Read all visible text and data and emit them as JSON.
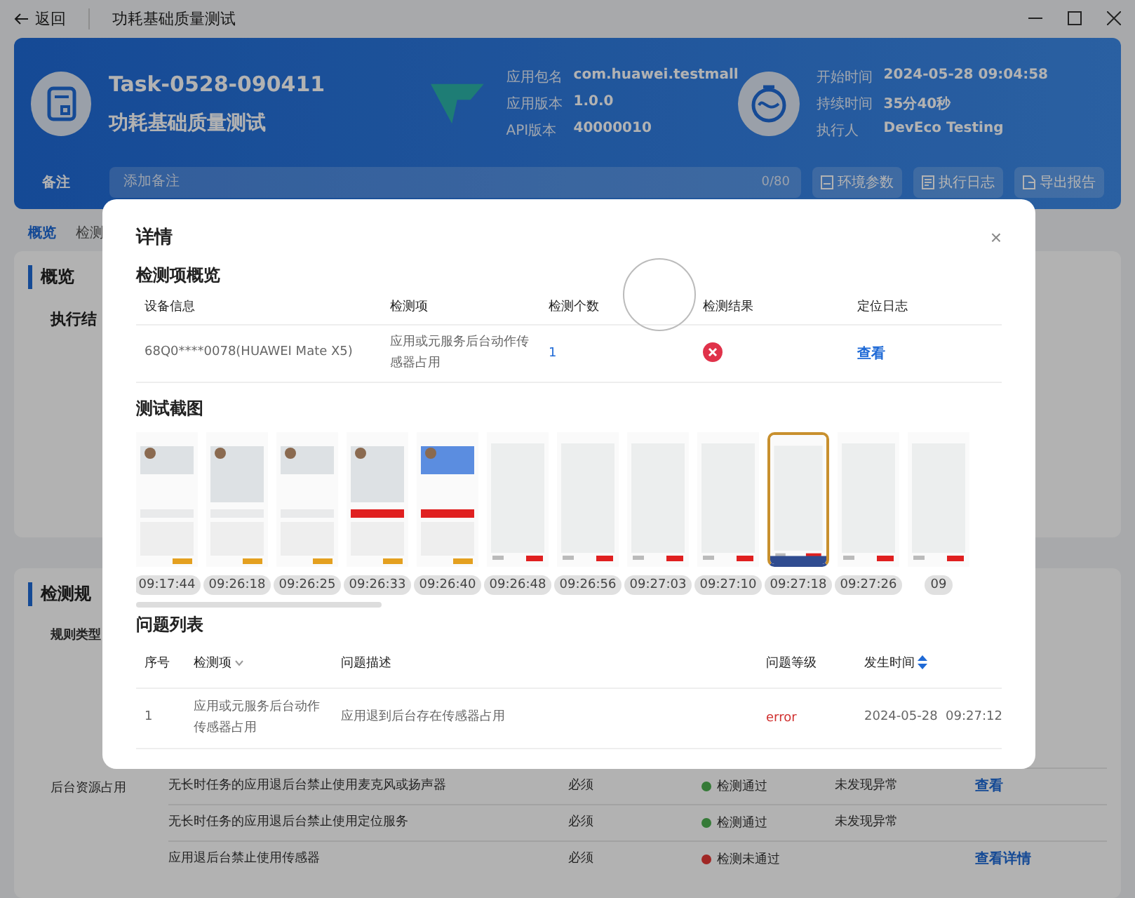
{
  "titlebar": {
    "back": "返回",
    "title": "功耗基础质量测试"
  },
  "header": {
    "task_id": "Task-0528-090411",
    "task_name": "功耗基础质量测试",
    "app_info": [
      {
        "label": "应用包名",
        "value": "com.huawei.testmall"
      },
      {
        "label": "应用版本",
        "value": "1.0.0"
      },
      {
        "label": "API版本",
        "value": "40000010"
      }
    ],
    "run_info": [
      {
        "label": "开始时间",
        "value": "2024-05-28 09:04:58"
      },
      {
        "label": "持续时间",
        "value": "35分40秒"
      },
      {
        "label": "执行人",
        "value": "DevEco Testing"
      }
    ],
    "note_label": "备注",
    "note": {
      "placeholder": "添加备注",
      "counter": "0/80"
    },
    "buttons": [
      {
        "kind": "env",
        "label": "环境参数"
      },
      {
        "kind": "log",
        "label": "执行日志"
      },
      {
        "kind": "export",
        "label": "导出报告"
      }
    ]
  },
  "tabs": [
    {
      "label": "概览",
      "selected": true
    },
    {
      "label": "检测",
      "selected": false
    }
  ],
  "overview": {
    "title": "概览",
    "result_label": "执行结"
  },
  "rules": {
    "title": "检测规",
    "type_header": "规则类型",
    "rows": [
      {
        "type": "后台资源占用",
        "name": "无长时任务的应用退后台禁止使用麦克风或扬声器",
        "level": "必须",
        "passed": true,
        "status": "检测通过",
        "result": "未发现异常",
        "action": "查看"
      },
      {
        "name": "无长时任务的应用退后台禁止使用定位服务",
        "level": "必须",
        "passed": true,
        "status": "检测通过",
        "result": "未发现异常"
      },
      {
        "name": "应用退后台禁止使用传感器",
        "level": "必须",
        "passed": false,
        "status": "检测未通过",
        "action": "查看详情"
      }
    ]
  },
  "dialog": {
    "title": "详情",
    "close": "×",
    "overview_title": "检测项概览",
    "overview_columns": [
      "设备信息",
      "检测项",
      "检测个数",
      "检测结果",
      "定位日志"
    ],
    "overview_row": {
      "device": "68Q0****0078(HUAWEI Mate X5)",
      "item": "应用或元服务后台动作传感器占用",
      "count": "1",
      "passed": false,
      "log": "查看"
    },
    "screenshots_title": "测试截图",
    "screenshots": [
      {
        "time": "09:17:44",
        "selected": false
      },
      {
        "time": "09:26:18",
        "selected": false
      },
      {
        "time": "09:26:25",
        "selected": false
      },
      {
        "time": "09:26:33",
        "selected": false
      },
      {
        "time": "09:26:40",
        "selected": false
      },
      {
        "time": "09:26:48",
        "selected": false
      },
      {
        "time": "09:26:56",
        "selected": false
      },
      {
        "time": "09:27:03",
        "selected": false
      },
      {
        "time": "09:27:10",
        "selected": false
      },
      {
        "time": "09:27:18",
        "selected": true
      },
      {
        "time": "09:27:26",
        "selected": false
      },
      {
        "time": "09",
        "selected": false
      }
    ],
    "issues_title": "问题列表",
    "issue_columns": [
      "序号",
      "检测项",
      "问题描述",
      "问题等级",
      "发生时间"
    ],
    "issues": [
      {
        "no": "1",
        "item": "应用或元服务后台动作传感器占用",
        "description": "应用退到后台存在传感器占用",
        "level": "error",
        "time": "2024-05-28  09:27:12"
      }
    ]
  }
}
